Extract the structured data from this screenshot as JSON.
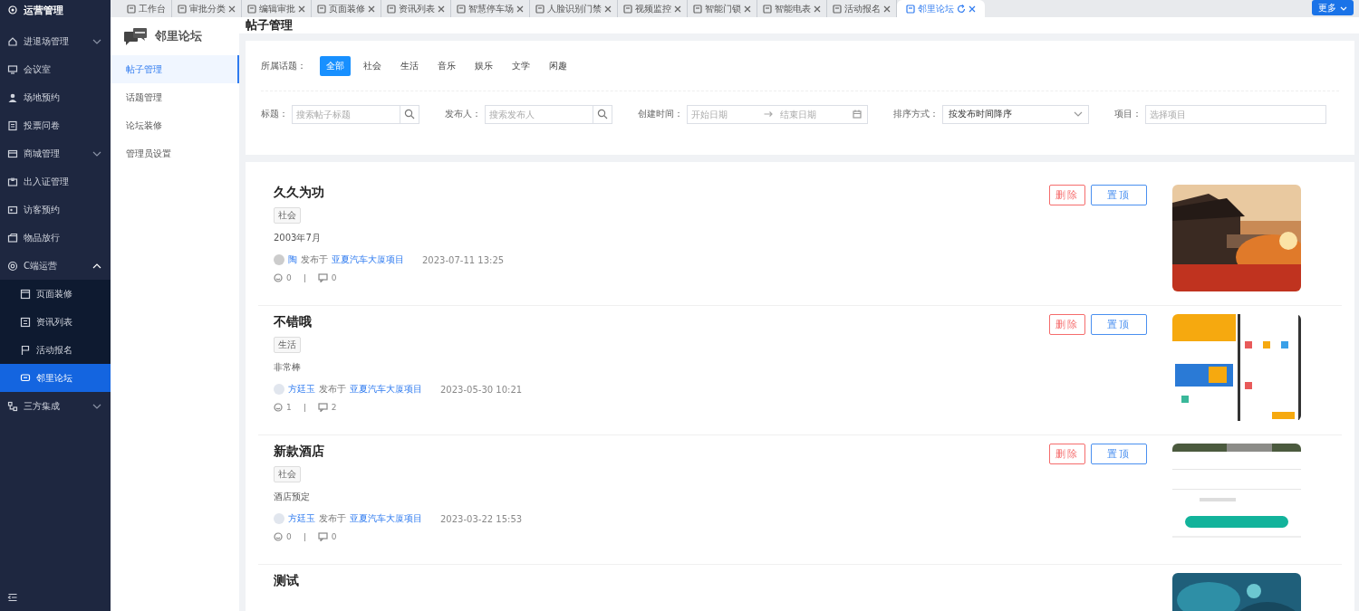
{
  "app": {
    "title": "运营管理"
  },
  "tabs": [
    {
      "label": "工作台",
      "closable": false,
      "selected": false
    },
    {
      "label": "审批分类",
      "closable": true,
      "selected": false
    },
    {
      "label": "编辑审批",
      "closable": true,
      "selected": false
    },
    {
      "label": "页面装修",
      "closable": true,
      "selected": false
    },
    {
      "label": "资讯列表",
      "closable": true,
      "selected": false
    },
    {
      "label": "智慧停车场",
      "closable": true,
      "selected": false
    },
    {
      "label": "人脸识别门禁",
      "closable": true,
      "selected": false
    },
    {
      "label": "视频监控",
      "closable": true,
      "selected": false
    },
    {
      "label": "智能门锁",
      "closable": true,
      "selected": false
    },
    {
      "label": "智能电表",
      "closable": true,
      "selected": false
    },
    {
      "label": "活动报名",
      "closable": true,
      "selected": false
    },
    {
      "label": "邻里论坛",
      "closable": true,
      "selected": true
    }
  ],
  "more_button": "更多",
  "sidebar": {
    "items": [
      {
        "label": "进退场管理",
        "expanded": false,
        "selected": false
      },
      {
        "label": "会议室",
        "selected": false
      },
      {
        "label": "场地预约",
        "selected": false
      },
      {
        "label": "投票问卷",
        "selected": false
      },
      {
        "label": "商城管理",
        "expanded": false,
        "selected": false
      },
      {
        "label": "出入证管理",
        "selected": false
      },
      {
        "label": "访客预约",
        "selected": false
      },
      {
        "label": "物品放行",
        "selected": false
      },
      {
        "label": "C端运营",
        "expanded": true,
        "selected": false,
        "children": [
          {
            "label": "页面装修",
            "selected": false
          },
          {
            "label": "资讯列表",
            "selected": false
          },
          {
            "label": "活动报名",
            "selected": false
          },
          {
            "label": "邻里论坛",
            "selected": true
          }
        ]
      },
      {
        "label": "三方集成",
        "expanded": false,
        "selected": false
      }
    ]
  },
  "forum_menu": {
    "title": "邻里论坛",
    "items": [
      {
        "label": "帖子管理",
        "selected": true
      },
      {
        "label": "话题管理",
        "selected": false
      },
      {
        "label": "论坛装修",
        "selected": false
      },
      {
        "label": "管理员设置",
        "selected": false
      }
    ]
  },
  "page_title": "帖子管理",
  "filters": {
    "topic_label": "所属话题：",
    "topics": [
      {
        "label": "全部",
        "selected": true
      },
      {
        "label": "社会",
        "selected": false
      },
      {
        "label": "生活",
        "selected": false
      },
      {
        "label": "音乐",
        "selected": false
      },
      {
        "label": "娱乐",
        "selected": false
      },
      {
        "label": "文学",
        "selected": false
      },
      {
        "label": "闲趣",
        "selected": false
      }
    ],
    "fields": [
      {
        "kind": "search",
        "label": "标题：",
        "placeholder": "搜索帖子标题"
      },
      {
        "kind": "search",
        "label": "发布人：",
        "placeholder": "搜索发布人"
      },
      {
        "kind": "daterange",
        "label": "创建时间：",
        "start_placeholder": "开始日期",
        "end_placeholder": "结束日期"
      },
      {
        "kind": "select",
        "label": "排序方式：",
        "value": "按发布时间降序"
      },
      {
        "kind": "text",
        "label": "项目：",
        "placeholder": "选择项目"
      }
    ]
  },
  "posts": [
    {
      "title": "久久为功",
      "tag": "社会",
      "content": "2003年7月",
      "author": "陶",
      "published_in": "发布于",
      "project": "亚夏汽车大厦项目",
      "time": "2023-07-11 13:25",
      "likes": "0",
      "comments": "0",
      "delete_button": "删除",
      "pin_button": "置顶"
    },
    {
      "title": "不错哦",
      "tag": "生活",
      "content": "非常棒",
      "author": "方廷玉",
      "published_in": "发布于",
      "project": "亚夏汽车大厦项目",
      "time": "2023-05-30 10:21",
      "likes": "1",
      "comments": "2",
      "delete_button": "删除",
      "pin_button": "置顶"
    },
    {
      "title": "新款酒店",
      "tag": "社会",
      "content": "酒店预定",
      "author": "方廷玉",
      "published_in": "发布于",
      "project": "亚夏汽车大厦项目",
      "time": "2023-03-22 15:53",
      "likes": "0",
      "comments": "0",
      "delete_button": "删除",
      "pin_button": "置顶"
    },
    {
      "title": "测试"
    }
  ]
}
